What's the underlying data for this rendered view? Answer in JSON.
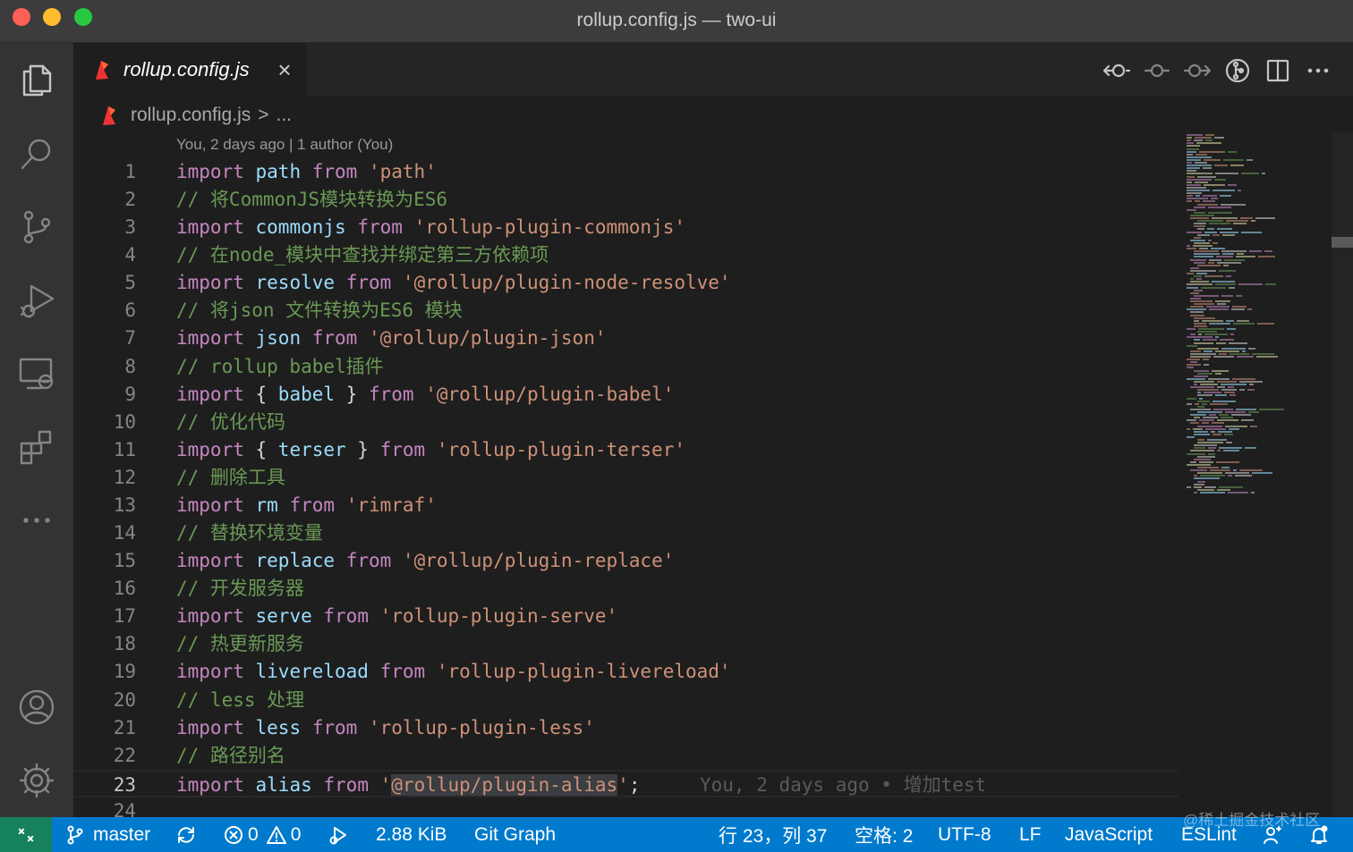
{
  "window": {
    "title": "rollup.config.js — two-ui"
  },
  "activity_bar": {
    "items": [
      "explorer-icon",
      "search-icon",
      "source-control-icon",
      "run-debug-icon",
      "remote-explorer-icon",
      "extensions-icon",
      "more-icon"
    ],
    "bottom": [
      "accounts-icon",
      "settings-gear-icon"
    ]
  },
  "tabs": [
    {
      "label": "rollup.config.js",
      "active": true,
      "italic": true
    }
  ],
  "editor_actions": [
    "go-back-icon",
    "git-commit-icon",
    "go-forward-icon",
    "git-graph-icon",
    "split-editor-icon",
    "more-actions-icon"
  ],
  "breadcrumb": {
    "file": "rollup.config.js",
    "separator": ">",
    "more": "..."
  },
  "codelens": "You, 2 days ago | 1 author (You)",
  "code_lines": [
    {
      "n": "1",
      "tokens": [
        [
          "kw",
          "import"
        ],
        [
          "pn",
          " "
        ],
        [
          "id",
          "path"
        ],
        [
          "pn",
          " "
        ],
        [
          "kw",
          "from"
        ],
        [
          "pn",
          " "
        ],
        [
          "str",
          "'path'"
        ]
      ]
    },
    {
      "n": "2",
      "tokens": [
        [
          "cm",
          "// 将CommonJS模块转换为ES6"
        ]
      ]
    },
    {
      "n": "3",
      "tokens": [
        [
          "kw",
          "import"
        ],
        [
          "pn",
          " "
        ],
        [
          "id",
          "commonjs"
        ],
        [
          "pn",
          " "
        ],
        [
          "kw",
          "from"
        ],
        [
          "pn",
          " "
        ],
        [
          "str",
          "'rollup-plugin-commonjs'"
        ]
      ]
    },
    {
      "n": "4",
      "tokens": [
        [
          "cm",
          "// 在node_模块中查找并绑定第三方依赖项"
        ]
      ]
    },
    {
      "n": "5",
      "tokens": [
        [
          "kw",
          "import"
        ],
        [
          "pn",
          " "
        ],
        [
          "id",
          "resolve"
        ],
        [
          "pn",
          " "
        ],
        [
          "kw",
          "from"
        ],
        [
          "pn",
          " "
        ],
        [
          "str",
          "'@rollup/plugin-node-resolve'"
        ]
      ]
    },
    {
      "n": "6",
      "tokens": [
        [
          "cm",
          "// 将json 文件转换为ES6 模块"
        ]
      ]
    },
    {
      "n": "7",
      "tokens": [
        [
          "kw",
          "import"
        ],
        [
          "pn",
          " "
        ],
        [
          "id",
          "json"
        ],
        [
          "pn",
          " "
        ],
        [
          "kw",
          "from"
        ],
        [
          "pn",
          " "
        ],
        [
          "str",
          "'@rollup/plugin-json'"
        ]
      ]
    },
    {
      "n": "8",
      "tokens": [
        [
          "cm",
          "// rollup babel插件"
        ]
      ]
    },
    {
      "n": "9",
      "tokens": [
        [
          "kw",
          "import"
        ],
        [
          "pn",
          " { "
        ],
        [
          "id",
          "babel"
        ],
        [
          "pn",
          " } "
        ],
        [
          "kw",
          "from"
        ],
        [
          "pn",
          " "
        ],
        [
          "str",
          "'@rollup/plugin-babel'"
        ]
      ]
    },
    {
      "n": "10",
      "tokens": [
        [
          "cm",
          "// 优化代码"
        ]
      ]
    },
    {
      "n": "11",
      "tokens": [
        [
          "kw",
          "import"
        ],
        [
          "pn",
          " { "
        ],
        [
          "id",
          "terser"
        ],
        [
          "pn",
          " } "
        ],
        [
          "kw",
          "from"
        ],
        [
          "pn",
          " "
        ],
        [
          "str",
          "'rollup-plugin-terser'"
        ]
      ]
    },
    {
      "n": "12",
      "tokens": [
        [
          "cm",
          "// 删除工具"
        ]
      ]
    },
    {
      "n": "13",
      "tokens": [
        [
          "kw",
          "import"
        ],
        [
          "pn",
          " "
        ],
        [
          "id",
          "rm"
        ],
        [
          "pn",
          " "
        ],
        [
          "kw",
          "from"
        ],
        [
          "pn",
          " "
        ],
        [
          "str",
          "'rimraf'"
        ]
      ]
    },
    {
      "n": "14",
      "tokens": [
        [
          "cm",
          "// 替换环境变量"
        ]
      ]
    },
    {
      "n": "15",
      "tokens": [
        [
          "kw",
          "import"
        ],
        [
          "pn",
          " "
        ],
        [
          "id",
          "replace"
        ],
        [
          "pn",
          " "
        ],
        [
          "kw",
          "from"
        ],
        [
          "pn",
          " "
        ],
        [
          "str",
          "'@rollup/plugin-replace'"
        ]
      ]
    },
    {
      "n": "16",
      "tokens": [
        [
          "cm",
          "// 开发服务器"
        ]
      ]
    },
    {
      "n": "17",
      "tokens": [
        [
          "kw",
          "import"
        ],
        [
          "pn",
          " "
        ],
        [
          "id",
          "serve"
        ],
        [
          "pn",
          " "
        ],
        [
          "kw",
          "from"
        ],
        [
          "pn",
          " "
        ],
        [
          "str",
          "'rollup-plugin-serve'"
        ]
      ]
    },
    {
      "n": "18",
      "tokens": [
        [
          "cm",
          "// 热更新服务"
        ]
      ]
    },
    {
      "n": "19",
      "tokens": [
        [
          "kw",
          "import"
        ],
        [
          "pn",
          " "
        ],
        [
          "id",
          "livereload"
        ],
        [
          "pn",
          " "
        ],
        [
          "kw",
          "from"
        ],
        [
          "pn",
          " "
        ],
        [
          "str",
          "'rollup-plugin-livereload'"
        ]
      ]
    },
    {
      "n": "20",
      "tokens": [
        [
          "cm",
          "// less 处理"
        ]
      ]
    },
    {
      "n": "21",
      "tokens": [
        [
          "kw",
          "import"
        ],
        [
          "pn",
          " "
        ],
        [
          "id",
          "less"
        ],
        [
          "pn",
          " "
        ],
        [
          "kw",
          "from"
        ],
        [
          "pn",
          " "
        ],
        [
          "str",
          "'rollup-plugin-less'"
        ]
      ]
    },
    {
      "n": "22",
      "tokens": [
        [
          "cm",
          "// 路径别名"
        ]
      ]
    },
    {
      "n": "23",
      "tokens": [
        [
          "kw",
          "import"
        ],
        [
          "pn",
          " "
        ],
        [
          "id",
          "alias"
        ],
        [
          "pn",
          " "
        ],
        [
          "kw",
          "from"
        ],
        [
          "pn",
          " "
        ],
        [
          "str",
          "'"
        ],
        [
          "sel",
          "@rollup/plugin-alias"
        ],
        [
          "str",
          "'"
        ],
        [
          "pn",
          ";"
        ]
      ],
      "current": true,
      "blame": "You, 2 days ago • 增加test"
    },
    {
      "n": "24",
      "tokens": []
    }
  ],
  "status_bar": {
    "branch": "master",
    "errors": "0",
    "warnings": "0",
    "file_size": "2.88 KiB",
    "git_graph": "Git Graph",
    "cursor": "行 23，列 37",
    "indent": "空格: 2",
    "encoding": "UTF-8",
    "eol": "LF",
    "language": "JavaScript",
    "linter": "ESLint"
  },
  "watermark": "@稀土掘金技术社区",
  "colors": {
    "keyword": "#c586c0",
    "identifier": "#9cdcfe",
    "string": "#ce9178",
    "comment": "#6a9955",
    "status_bar": "#007acc",
    "remote": "#16825d"
  }
}
